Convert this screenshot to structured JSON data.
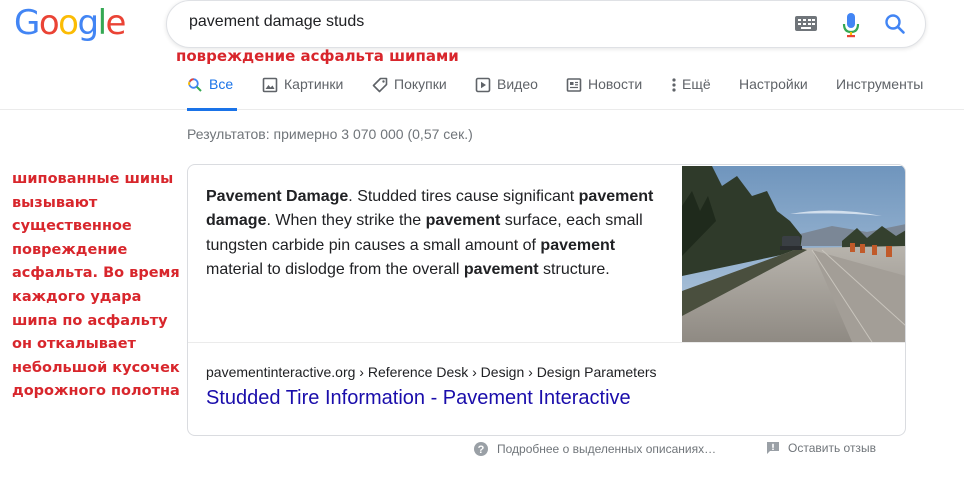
{
  "logo": {
    "letters": [
      "G",
      "o",
      "o",
      "g",
      "l",
      "e"
    ],
    "colors": [
      "#4285f4",
      "#ea4335",
      "#fbbc05",
      "#4285f4",
      "#34a853",
      "#ea4335"
    ]
  },
  "search": {
    "query": "pavement damage studs"
  },
  "translation_note": "повреждение асфальта шипами",
  "tabs": [
    {
      "label": "Все",
      "icon": "search-icon",
      "active": true
    },
    {
      "label": "Картинки",
      "icon": "image-icon"
    },
    {
      "label": "Покупки",
      "icon": "tag-icon"
    },
    {
      "label": "Видео",
      "icon": "play-icon"
    },
    {
      "label": "Новости",
      "icon": "news-icon"
    },
    {
      "label": "Ещё",
      "icon": "more-vert-icon"
    },
    {
      "label": "Настройки"
    },
    {
      "label": "Инструменты"
    }
  ],
  "result_stats": "Результатов: примерно 3 070 000 (0,57 сек.)",
  "side_note": "шипованные шины вызывают существенное повреждение асфальта. Во время каждого удара шипа по асфальту он откалывает небольшой кусочек дорожного полотна",
  "featured_snippet": {
    "segments": [
      {
        "text": "Pavement Damage",
        "bold": true
      },
      {
        "text": ". Studded tires cause significant ",
        "bold": false
      },
      {
        "text": "pavement damage",
        "bold": true
      },
      {
        "text": ". When they strike the ",
        "bold": false
      },
      {
        "text": "pavement",
        "bold": true
      },
      {
        "text": " surface, each small tungsten carbide pin causes a small amount of ",
        "bold": false
      },
      {
        "text": "pavement",
        "bold": true
      },
      {
        "text": " material to dislodge from the overall ",
        "bold": false
      },
      {
        "text": "pavement",
        "bold": true
      },
      {
        "text": " structure.",
        "bold": false
      }
    ],
    "breadcrumb": "pavementinteractive.org › Reference Desk › Design › Design Parameters",
    "title": "Studded Tire Information - Pavement Interactive"
  },
  "footer": {
    "about_snippets": "Подробнее о выделенных описаниях…",
    "feedback": "Оставить отзыв"
  },
  "colors": {
    "accent": "#1a73e8",
    "link": "#1a0dab",
    "note_red": "#d8262c"
  }
}
